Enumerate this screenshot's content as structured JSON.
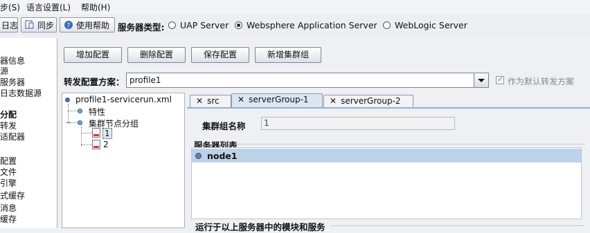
{
  "menu": {
    "items": [
      {
        "label": "步(S)"
      },
      {
        "label": "语言设置(L)"
      },
      {
        "label": "帮助(H)"
      }
    ]
  },
  "toolbar": {
    "log_label": "日志",
    "sync_label": "同步",
    "help_label": "使用帮助",
    "server_type_label": "服务器类型:",
    "server_types": [
      {
        "label": "UAP Server",
        "selected": false
      },
      {
        "label": "Websphere Application Server",
        "selected": true
      },
      {
        "label": "WebLogic Server",
        "selected": false
      }
    ]
  },
  "sidebar": {
    "items": [
      {
        "label": "器信息"
      },
      {
        "label": "源"
      },
      {
        "label": "服务器"
      },
      {
        "label": "日志数据源"
      },
      {
        "label": "分配"
      },
      {
        "label": "转发"
      },
      {
        "label": "适配器"
      },
      {
        "label": "配置"
      },
      {
        "label": "文件"
      },
      {
        "label": "引擎"
      },
      {
        "label": "式缓存"
      },
      {
        "label": "消息"
      },
      {
        "label": "缓存"
      }
    ]
  },
  "actions": {
    "add_config": "增加配置",
    "delete_config": "删除配置",
    "save_config": "保存配置",
    "add_cluster": "新增集群组"
  },
  "scheme": {
    "label": "转发配置方案：",
    "value": "profile1",
    "default_label": "作为默认转发方案",
    "default_checked": true
  },
  "tree": {
    "root": "profile1-servicerun.xml",
    "properties": "特性",
    "cluster_group": "集群节点分组",
    "nodes": [
      "1",
      "2"
    ]
  },
  "tabs": [
    {
      "label": "src",
      "active": false
    },
    {
      "label": "serverGroup-1",
      "active": true
    },
    {
      "label": "serverGroup-2",
      "active": false
    }
  ],
  "group": {
    "name_label": "集群组名称",
    "name_value": "1"
  },
  "server_list": {
    "legend": "服务器列表",
    "rows": [
      "node1"
    ]
  },
  "modules": {
    "legend": "运行于以上服务器中的模块和服务"
  }
}
